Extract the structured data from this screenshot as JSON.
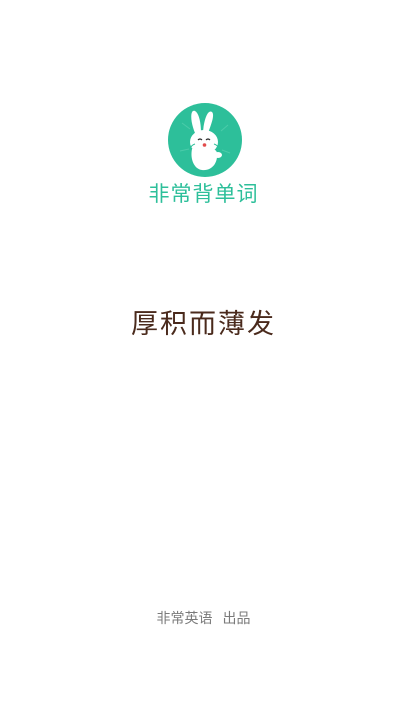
{
  "app": {
    "name": "非常背单词",
    "logo_icon": "rabbit-logo-icon"
  },
  "main": {
    "slogan": "厚积而薄发"
  },
  "footer": {
    "brand": "非常英语",
    "suffix": "出品"
  },
  "colors": {
    "brand_green": "#2dbf9a",
    "slogan_brown": "#4a2a1c",
    "footer_gray": "#7a7a7a",
    "background": "#ffffff"
  }
}
